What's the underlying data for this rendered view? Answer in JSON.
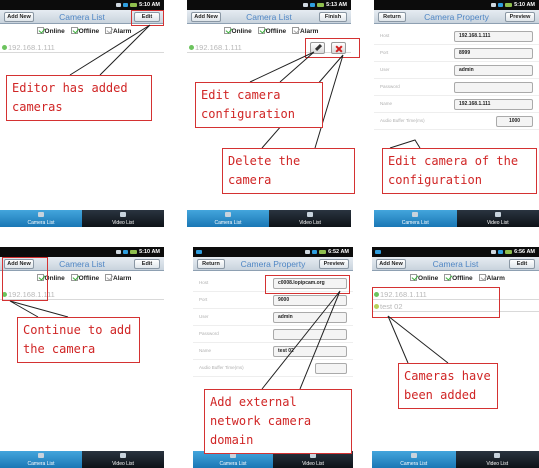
{
  "panels": [
    {
      "time": "5:10 AM",
      "title": "Camera List",
      "left_button": "Add New",
      "right_button": "Edit",
      "filters": {
        "online": "Online",
        "offline": "Offline",
        "alarm": "Alarm"
      },
      "cameras": [
        "192.168.1.111"
      ],
      "tabs": {
        "active": "Camera List",
        "inactive": "Video List"
      }
    },
    {
      "time": "5:13 AM",
      "title": "Camera List",
      "left_button": "Add New",
      "right_button": "Finish",
      "filters": {
        "online": "Online",
        "offline": "Offline",
        "alarm": "Alarm"
      },
      "cameras": [
        "192.168.1.111"
      ],
      "tabs": {
        "active": "Camera List",
        "inactive": "Video List"
      }
    },
    {
      "time": "5:10 AM",
      "title": "Camera Property",
      "left_button": "Return",
      "right_button": "Preview",
      "fields": [
        {
          "label": "Host",
          "value": "192.168.1.111"
        },
        {
          "label": "Port",
          "value": "8999"
        },
        {
          "label": "User",
          "value": "admin"
        },
        {
          "label": "Password",
          "value": ""
        },
        {
          "label": "Name",
          "value": "192.168.1.111"
        },
        {
          "label": "Audio Buffer Time(ms)",
          "value": "1000"
        }
      ],
      "tabs": {
        "active": "Camera List",
        "inactive": "Video List"
      }
    },
    {
      "time": "5:10 AM",
      "title": "Camera List",
      "left_button": "Add New",
      "right_button": "Edit",
      "filters": {
        "online": "Online",
        "offline": "Offline",
        "alarm": "Alarm"
      },
      "cameras": [
        "192.168.1.111"
      ],
      "tabs": {
        "active": "Camera List",
        "inactive": "Video List"
      }
    },
    {
      "time": "6:52 AM",
      "title": "Camera Property",
      "left_button": "Return",
      "right_button": "Preview",
      "fields": [
        {
          "label": "Host",
          "value": "c0008.lopipcam.org"
        },
        {
          "label": "Port",
          "value": "9000"
        },
        {
          "label": "User",
          "value": "admin"
        },
        {
          "label": "Password",
          "value": ""
        },
        {
          "label": "Name",
          "value": "test 02"
        },
        {
          "label": "Audio Buffer Time(ms)",
          "value": ""
        }
      ],
      "tabs": {
        "active": "Camera List",
        "inactive": "Video List"
      }
    },
    {
      "time": "6:56 AM",
      "title": "Camera List",
      "left_button": "Add New",
      "right_button": "Edit",
      "filters": {
        "online": "Online",
        "offline": "Offline",
        "alarm": "Alarm"
      },
      "cameras": [
        "192.168.1.111",
        "test 02"
      ],
      "tabs": {
        "active": "Camera List",
        "inactive": "Video List"
      }
    }
  ],
  "callouts": {
    "c1": "Editor has added cameras",
    "c2": "Edit camera configuration",
    "c3": "Delete the camera",
    "c4": "Edit camera of the configuration",
    "c5": "Continue to add the camera",
    "c6": "Add external network camera domain",
    "c7": "Cameras have been added"
  },
  "colors": {
    "annotation": "#d43232",
    "title": "#4f86c4",
    "online_dot": "#6cc35e",
    "tab_active": "#1a77b5"
  }
}
